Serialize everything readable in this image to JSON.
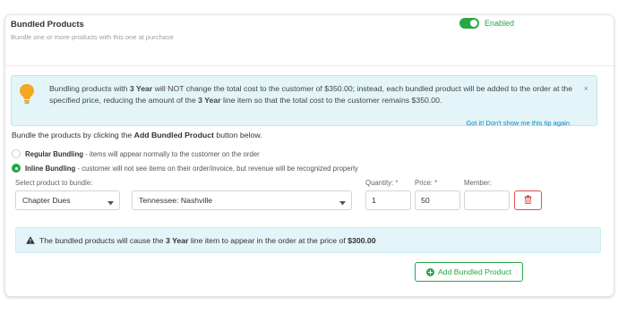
{
  "section": {
    "title": "Bundled Products",
    "subtitle": "Bundle one or more products with this one at purchase",
    "toggle_label": "Enabled",
    "toggle_on": true
  },
  "tip": {
    "text_1": "Bundling products with ",
    "bold_1": "3 Year",
    "text_2": " will NOT change the total cost to the customer of $350.00; instead, each bundled product will be added to the order at the specified price, reducing the amount of the ",
    "bold_2": "3 Year",
    "text_3": " line item so that the total cost to the customer remains $350.00.",
    "dismiss_link": "Got it! Don't show me this tip again",
    "close_symbol": "×",
    "icon": "lightbulb-icon"
  },
  "instruction": {
    "text_1": "Bundle the products by clicking the ",
    "bold": "Add Bundled Product",
    "text_2": " button below."
  },
  "bundling_options": [
    {
      "label": "Regular Bundling",
      "description": " - items will appear normally to the customer on the order",
      "selected": false
    },
    {
      "label": "Inline Bundling",
      "description": " - customer will not see items on their order/invoice, but revenue will be recognized properly",
      "selected": true
    }
  ],
  "product_row": {
    "select_label": "Select product to bundle:",
    "product_value": "Chapter Dues",
    "variant_value": "Tennessee: Nashville",
    "quantity_label": "Quantity:",
    "quantity_value": "1",
    "price_label": "Price:",
    "price_value": "50",
    "member_label": "Member:",
    "member_value": "",
    "required_mark": "*"
  },
  "summary": {
    "text_1": "The bundled products will cause the ",
    "bold_1": "3 Year",
    "text_2": " line item to appear in the order at the price of ",
    "bold_2": "$300.00"
  },
  "add_button_label": "Add Bundled Product",
  "colors": {
    "accent_green": "#28a745",
    "info_bg": "#e3f5f9",
    "danger": "#d9534f",
    "bulb": "#f5a623"
  }
}
